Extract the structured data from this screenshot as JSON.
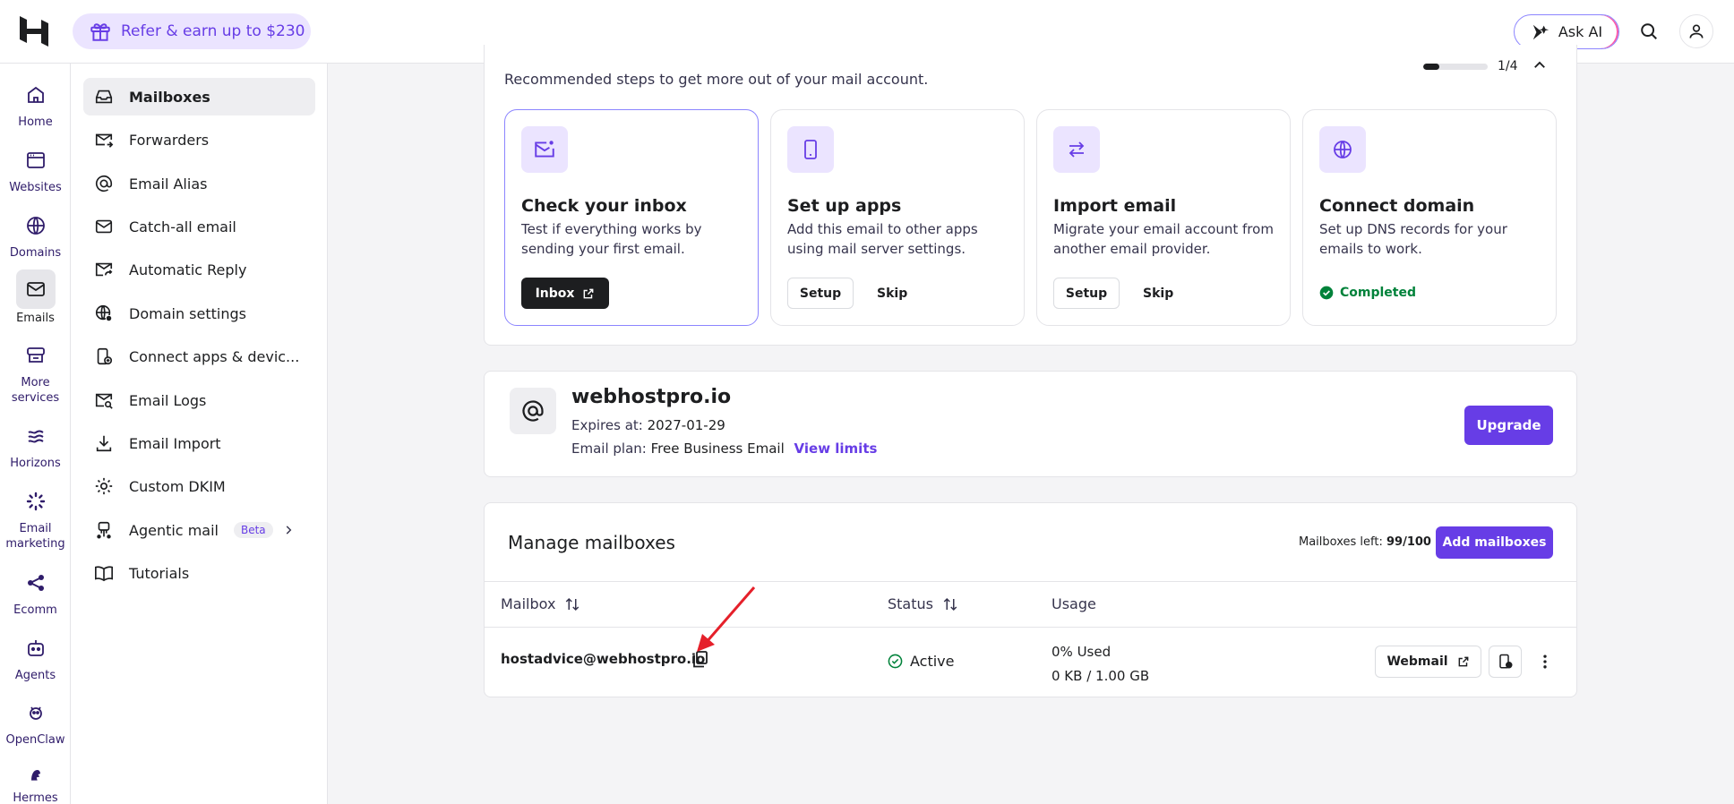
{
  "topbar": {
    "refer_label": "Refer & earn up to $230",
    "ask_ai_label": "Ask AI"
  },
  "rail": {
    "items": [
      {
        "label": "Home",
        "icon": "home-icon"
      },
      {
        "label": "Websites",
        "icon": "websites-icon"
      },
      {
        "label": "Domains",
        "icon": "globe-icon"
      },
      {
        "label": "Emails",
        "icon": "mail-icon"
      },
      {
        "label": "More services",
        "icon": "services-icon"
      },
      {
        "label": "Horizons",
        "icon": "horizons-icon"
      },
      {
        "label": "Email marketing",
        "icon": "email-marketing-icon"
      },
      {
        "label": "Ecomm",
        "icon": "ecomm-icon"
      },
      {
        "label": "Agents",
        "icon": "agents-icon"
      },
      {
        "label": "OpenClaw",
        "icon": "openclaw-icon"
      },
      {
        "label": "Hermes",
        "icon": "hermes-icon"
      }
    ]
  },
  "subnav": {
    "items": [
      {
        "label": "Mailboxes"
      },
      {
        "label": "Forwarders"
      },
      {
        "label": "Email Alias"
      },
      {
        "label": "Catch-all email"
      },
      {
        "label": "Automatic Reply"
      },
      {
        "label": "Domain settings"
      },
      {
        "label": "Connect apps & devic..."
      },
      {
        "label": "Email Logs"
      },
      {
        "label": "Email Import"
      },
      {
        "label": "Custom DKIM"
      },
      {
        "label": "Agentic mail",
        "badge": "Beta"
      },
      {
        "label": "Tutorials"
      }
    ]
  },
  "onboarding": {
    "subtitle": "Recommended steps to get more out of your mail account.",
    "progress_text": "1/4",
    "progress_fraction": 0.25,
    "steps": [
      {
        "title": "Check your inbox",
        "desc": "Test if everything works by sending your first email.",
        "primary": "Inbox"
      },
      {
        "title": "Set up apps",
        "desc": "Add this email to other apps using mail server settings.",
        "primary": "Setup",
        "secondary": "Skip"
      },
      {
        "title": "Import email",
        "desc": "Migrate your email account from another email provider.",
        "primary": "Setup",
        "secondary": "Skip"
      },
      {
        "title": "Connect domain",
        "desc": "Set up DNS records for your emails to work.",
        "status": "Completed"
      }
    ]
  },
  "domain": {
    "name": "webhostpro.io",
    "expires_label": "Expires at:",
    "expires_value": "2027-01-29",
    "plan_label": "Email plan:",
    "plan_value": "Free Business Email",
    "view_limits": "View limits",
    "upgrade_label": "Upgrade"
  },
  "mailboxes": {
    "title": "Manage mailboxes",
    "left_label": "Mailboxes left:",
    "left_value": "99/100",
    "add_label": "Add mailboxes",
    "columns": [
      "Mailbox",
      "Status",
      "Usage"
    ],
    "rows": [
      {
        "mailbox": "hostadvice@webhostpro.io",
        "status": "Active",
        "usage_pct": "0% Used",
        "usage_amount": "0 KB / 1.00 GB",
        "webmail": "Webmail"
      }
    ]
  },
  "colors": {
    "accent": "#673de6",
    "success": "#00823a",
    "annotation": "#e5202a"
  }
}
